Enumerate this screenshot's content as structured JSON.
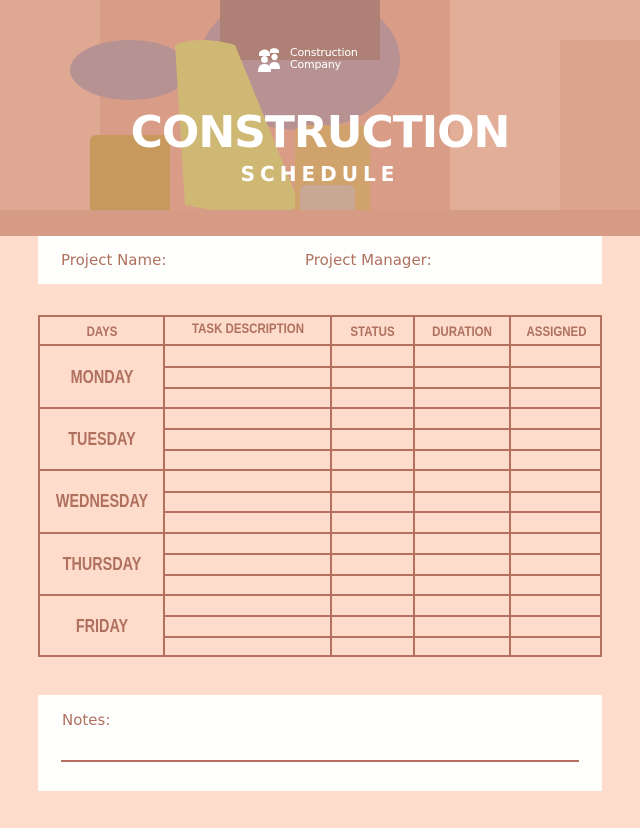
{
  "header": {
    "logo_icon": "construction-workers-icon",
    "company_line1": "Construction",
    "company_line2": "Company",
    "title": "CONSTRUCTION",
    "subtitle": "SCHEDULE"
  },
  "project": {
    "name_label": "Project Name:",
    "manager_label": "Project Manager:"
  },
  "schedule": {
    "columns": [
      "DAYS",
      "TASK DESCRIPTION",
      "STATUS",
      "DURATION",
      "ASSIGNED"
    ],
    "days": [
      "MONDAY",
      "TUESDAY",
      "WEDNESDAY",
      "THURSDAY",
      "FRIDAY"
    ],
    "rows_per_day": 3
  },
  "notes": {
    "label": "Notes:"
  },
  "colors": {
    "background": "#FEDCCC",
    "accent": "#B6705F",
    "text": "#B0705E",
    "panel": "#FEFFFD"
  }
}
